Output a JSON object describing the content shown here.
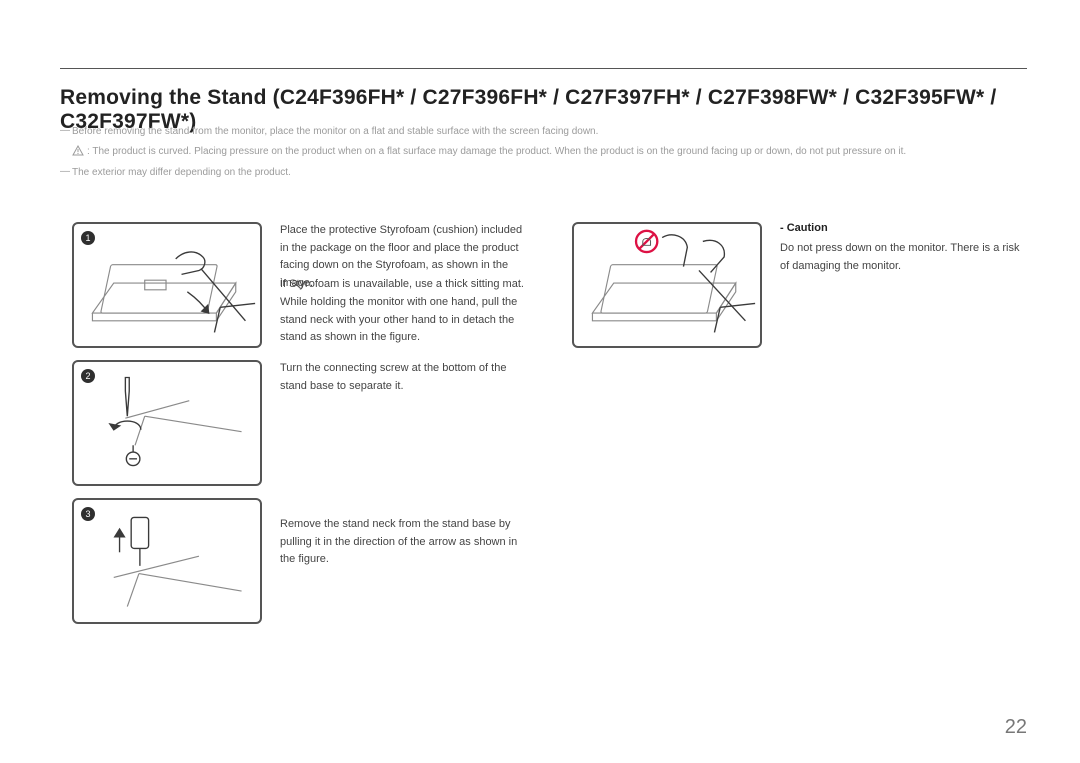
{
  "heading": "Removing the Stand (C24F396FH* / C27F396FH* / C27F397FH* / C27F398FW* / C32F395FW* / C32F397FW*)",
  "notes": {
    "n1": "Before removing the stand from the monitor, place the monitor on a flat and stable surface with the screen facing down.",
    "n2": ": The product is curved. Placing pressure on the product when on a flat surface may damage the product. When the product is on the ground facing up or down, do not put pressure on it.",
    "n3": "The exterior may differ depending on the product."
  },
  "steps": {
    "s1": {
      "num": "1",
      "text1": "Place the protective Styrofoam (cushion) included in the package on the floor and place the product facing down on the Styrofoam, as shown in the image.",
      "text2": "If Styrofoam is unavailable, use a thick sitting mat.",
      "text3": "While holding the monitor with one hand, pull the stand neck with your other hand to in detach the stand as shown in the figure."
    },
    "s2": {
      "num": "2",
      "text": "Turn the connecting screw at the bottom of the stand base to separate it."
    },
    "s3": {
      "num": "3",
      "text": "Remove the stand neck from the stand base by pulling it in the direction of the arrow as shown in the figure."
    }
  },
  "caution": {
    "head": "- Caution",
    "text": "Do not press down on the monitor. There is a risk of damaging the monitor."
  },
  "page_number": "22"
}
